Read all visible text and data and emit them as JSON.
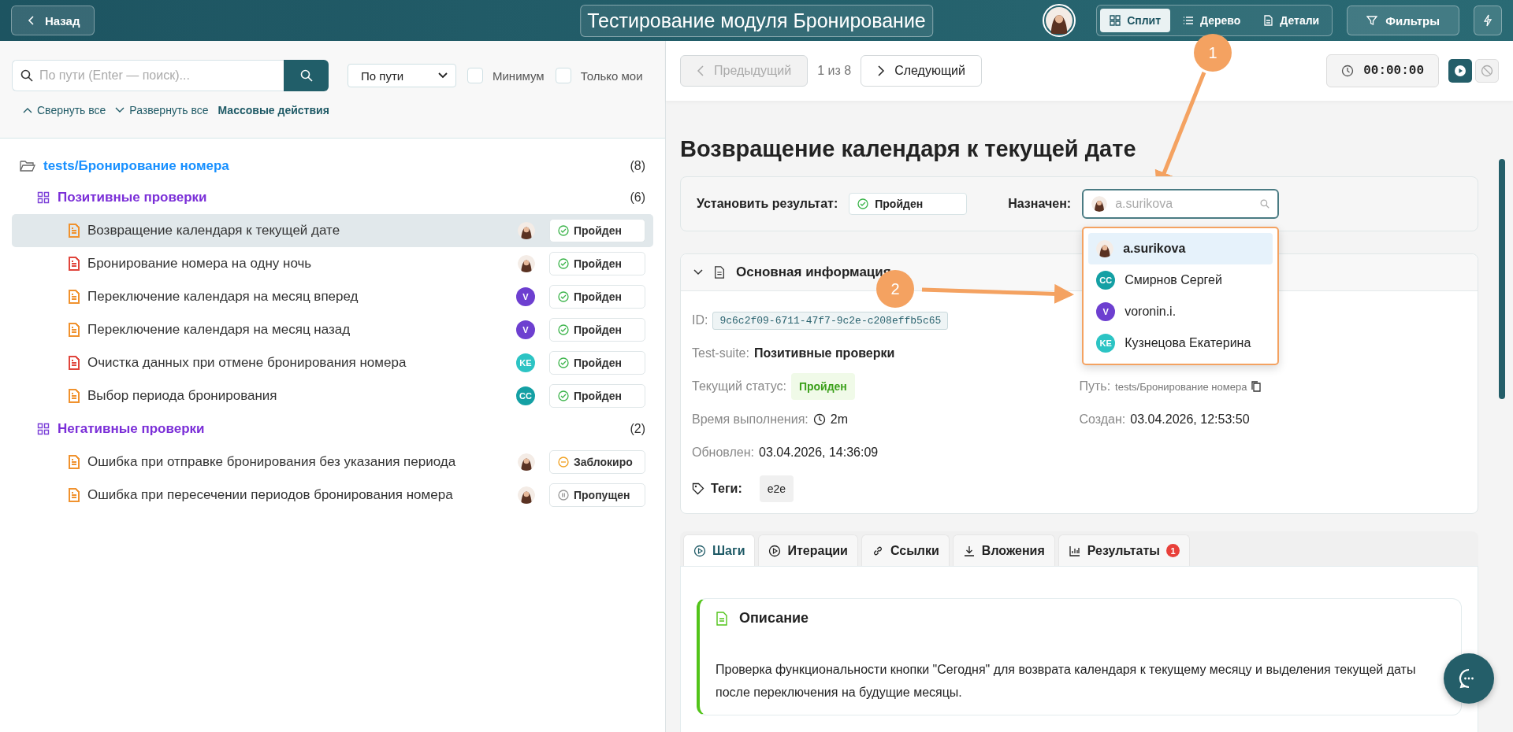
{
  "header": {
    "back": "Назад",
    "title": "Тестирование модуля Бронирование",
    "view_modes": [
      {
        "label": "Сплит",
        "kind": "split",
        "selected": true
      },
      {
        "label": "Дерево",
        "kind": "tree",
        "selected": false
      },
      {
        "label": "Детали",
        "kind": "details",
        "selected": false
      }
    ],
    "filters": "Фильтры"
  },
  "left": {
    "search": {
      "placeholder": "По пути (Enter — поиск)..."
    },
    "sort": {
      "value": "По пути"
    },
    "checkboxes": [
      {
        "label": "Минимум",
        "checked": false
      },
      {
        "label": "Только мои",
        "checked": false
      }
    ],
    "actions": [
      {
        "label": "Свернуть все",
        "kind": "collapse"
      },
      {
        "label": "Развернуть все",
        "kind": "expand"
      },
      {
        "label": "Массовые действия",
        "kind": "bulk"
      }
    ],
    "tree": {
      "name": "tests/Бронирование номера",
      "count": "(8)",
      "children": [
        {
          "name": "Позитивные проверки",
          "count": "(6)",
          "children": [
            {
              "title": "Возвращение календаря к текущей дате",
              "color": "#f0922e",
              "assignee": {
                "kind": "photo"
              },
              "status": {
                "kind": "passed",
                "label": "Пройден"
              },
              "selected": true
            },
            {
              "title": "Бронирование номера на одну ночь",
              "color": "#e0453c",
              "assignee": {
                "kind": "photo"
              },
              "status": {
                "kind": "passed",
                "label": "Пройден"
              },
              "selected": false
            },
            {
              "title": "Переключение календаря на месяц вперед",
              "color": "#f0922e",
              "assignee": {
                "kind": "initials",
                "initials": "V",
                "color": "#6d3fd0"
              },
              "status": {
                "kind": "passed",
                "label": "Пройден"
              },
              "selected": false
            },
            {
              "title": "Переключение календаря на месяц назад",
              "color": "#f0922e",
              "assignee": {
                "kind": "initials",
                "initials": "V",
                "color": "#6d3fd0"
              },
              "status": {
                "kind": "passed",
                "label": "Пройден"
              },
              "selected": false
            },
            {
              "title": "Очистка данных при отмене бронирования номера",
              "color": "#e0453c",
              "assignee": {
                "kind": "initials",
                "initials": "KE",
                "color": "#2cc4c4"
              },
              "status": {
                "kind": "passed",
                "label": "Пройден"
              },
              "selected": false
            },
            {
              "title": "Выбор периода бронирования",
              "color": "#f0922e",
              "assignee": {
                "kind": "initials",
                "initials": "CC",
                "color": "#14a0a4"
              },
              "status": {
                "kind": "passed",
                "label": "Пройден"
              },
              "selected": false
            }
          ]
        },
        {
          "name": "Негативные проверки",
          "count": "(2)",
          "children": [
            {
              "title": "Ошибка при отправке бронирования без указания периода",
              "color": "#f0922e",
              "assignee": {
                "kind": "photo"
              },
              "status": {
                "kind": "blocked",
                "label": "Заблокиро"
              },
              "selected": false
            },
            {
              "title": "Ошибка при пересечении периодов бронирования номера",
              "color": "#f0922e",
              "assignee": {
                "kind": "photo"
              },
              "status": {
                "kind": "skipped",
                "label": "Пропущен"
              },
              "selected": false
            }
          ]
        }
      ]
    }
  },
  "detail": {
    "prev": {
      "label": "Предыдущий",
      "disabled": true
    },
    "position": "1 из 8",
    "next": {
      "label": "Следующий",
      "disabled": false
    },
    "timer": "00:00:00",
    "timer_buttons": [
      {
        "kind": "play",
        "disabled": false
      },
      {
        "kind": "stop",
        "disabled": true
      }
    ],
    "title": "Возвращение календаря к текущей дате",
    "result": {
      "label": "Установить результат:",
      "value": "Пройден"
    },
    "assignee": {
      "label": "Назначен:",
      "placeholder": "a.surikova",
      "options": [
        {
          "name": "a.surikova",
          "avatar": {
            "kind": "photo"
          },
          "selected": true
        },
        {
          "name": "Смирнов Сергей",
          "avatar": {
            "kind": "initials",
            "initials": "CC",
            "color": "#14a0a4"
          },
          "selected": false
        },
        {
          "name": "voronin.i.",
          "avatar": {
            "kind": "initials",
            "initials": "V",
            "color": "#6d3fd0"
          },
          "selected": false
        },
        {
          "name": "Кузнецова Екатерина",
          "avatar": {
            "kind": "initials",
            "initials": "KE",
            "color": "#2cc4c4"
          },
          "selected": false
        }
      ]
    },
    "info": {
      "title": "Основная информация",
      "expanded": true,
      "rows": [
        [
          {
            "label": "ID:",
            "value": "9c6c2f09-6711-47f7-9c2e-c208effb5c65",
            "kind": "code"
          }
        ],
        [
          {
            "label": "Test-suite:",
            "value": "Позитивные проверки",
            "kind": "bold"
          }
        ],
        [
          {
            "label": "Текущий статус:",
            "value": "Пройден",
            "kind": "badge"
          },
          {
            "label": "Путь:",
            "value": "tests/Бронирование номера",
            "kind": "path"
          }
        ],
        [
          {
            "label": "Время выполнения:",
            "value": "2m",
            "kind": "duration"
          },
          {
            "label": "Создан:",
            "value": "03.04.2026, 12:53:50",
            "kind": "text"
          }
        ],
        [
          {
            "label": "Обновлен:",
            "value": "03.04.2026, 14:36:09",
            "kind": "text"
          }
        ]
      ],
      "tags": {
        "label": "Теги:",
        "items": [
          "e2e"
        ]
      }
    },
    "tabs": [
      {
        "label": "Шаги",
        "kind": "steps",
        "selected": true
      },
      {
        "label": "Итерации",
        "kind": "iterations",
        "selected": false
      },
      {
        "label": "Ссылки",
        "kind": "links",
        "selected": false
      },
      {
        "label": "Вложения",
        "kind": "attachments",
        "selected": false
      },
      {
        "label": "Результаты",
        "kind": "results",
        "selected": false,
        "badge": "1"
      }
    ],
    "description": {
      "title": "Описание",
      "text": "Проверка функциональности кнопки \"Сегодня\" для возврата календаря к текущему месяцу и выделения текущей даты после переключения на будущие месяцы."
    }
  },
  "annotations": [
    {
      "label": "1"
    },
    {
      "label": "2"
    }
  ]
}
